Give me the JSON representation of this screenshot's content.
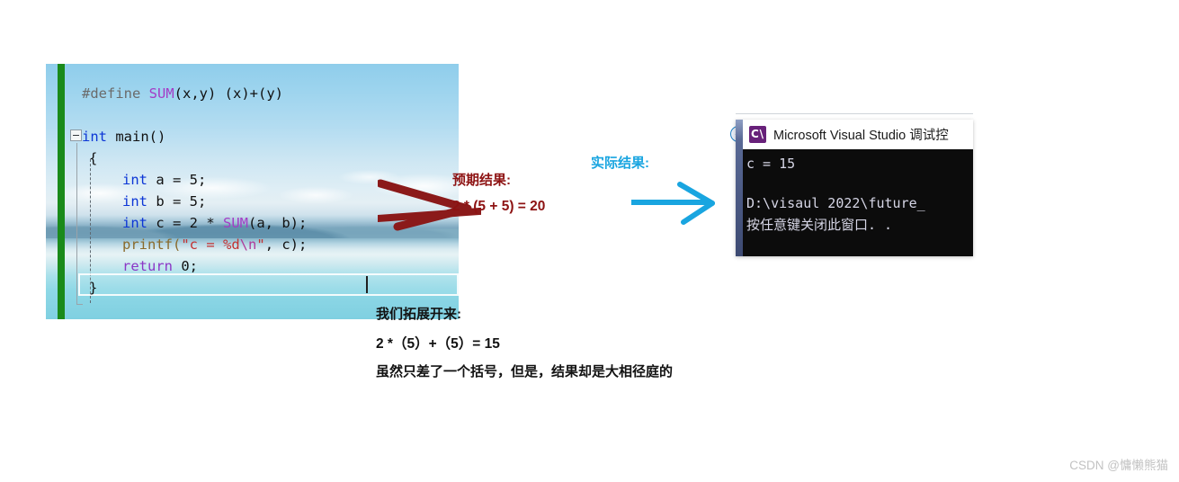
{
  "editor": {
    "lines": [
      {
        "id": "define",
        "text": "#define SUM(x,y) (x)+(y)"
      },
      {
        "id": "main",
        "text": "int main()"
      },
      {
        "id": "open",
        "text": "{"
      },
      {
        "id": "decl_a",
        "text": "int a = 5;"
      },
      {
        "id": "decl_b",
        "text": "int b = 5;"
      },
      {
        "id": "decl_c",
        "text": "int c = 2 * SUM(a, b);"
      },
      {
        "id": "printf",
        "text": "printf(\"c = %d\\n\", c);"
      },
      {
        "id": "return",
        "text": "return 0;"
      },
      {
        "id": "close",
        "text": "}"
      }
    ],
    "tokens": {
      "define_kw": "#define",
      "macro_name": "SUM",
      "macro_params": "(x,y) (x)+(y)",
      "int_kw": "int",
      "main_sig": " main()",
      "brace_open": "{",
      "brace_close": "}",
      "a_decl": " a = 5;",
      "b_decl": " b = 5;",
      "c_decl_pre": " c = 2 * ",
      "c_decl_args": "(a, b);",
      "printf_name": "printf",
      "printf_open": "(",
      "printf_str_a": "\"c = %d",
      "printf_str_esc": "\\n",
      "printf_str_b": "\"",
      "printf_rest": ", c);",
      "return_kw": "return",
      "return_val": " 0;"
    },
    "colors": {
      "keyword": "#0c36d6",
      "macro_grey": "#6b6b6b",
      "macro_name": "#a43cc6",
      "function": "#8a6a2b",
      "string": "#c33232",
      "escape": "#b03b9a",
      "return_kw": "#8b36c6",
      "change_bar_green": "#1a8a1a"
    }
  },
  "annotations": {
    "expected_label": "预期结果:",
    "expected_expr": "2 * (5 + 5) = 20",
    "actual_label": "实际结果:",
    "expand_label": "我们拓展开来:",
    "expand_expr": "2 *（5）+（5）= 15",
    "conclusion": "虽然只差了一个括号，但是，结果却是大相径庭的",
    "colors": {
      "expected": "#8d1212",
      "actual": "#19a5e0",
      "body": "#121212",
      "red_arrow": "#8b1a1a",
      "blue_arrow": "#19a5e0"
    }
  },
  "console": {
    "title": "Microsoft Visual Studio 调试控",
    "icon_label": "vs-console-icon",
    "output_line_1": "c = 15",
    "output_line_2": "D:\\visaul 2022\\future_",
    "output_line_3": "按任意键关闭此窗口. .",
    "background": "#0c0c0c",
    "text_color": "#d6d6e6"
  },
  "back_button": {
    "glyph": "←"
  },
  "watermark": {
    "text": "CSDN @慵懒熊猫"
  }
}
